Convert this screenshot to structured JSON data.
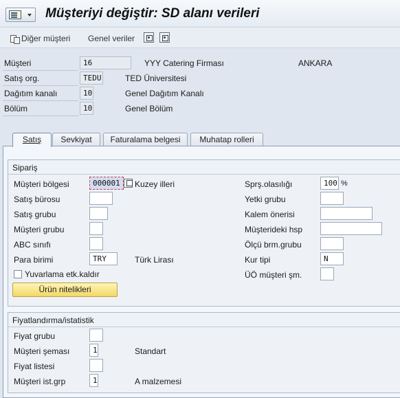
{
  "window": {
    "title": "Müşteriyi değiştir: SD alanı verileri"
  },
  "toolbar": {
    "other_customer": "Diğer müşteri",
    "general_data": "Genel veriler"
  },
  "header": {
    "customer_label": "Müşteri",
    "customer_value": "16",
    "customer_name": "YYY Catering Firması",
    "customer_city": "ANKARA",
    "sales_org_label": "Satış org.",
    "sales_org_value": "TEDU",
    "sales_org_name": "TED Üniversitesi",
    "dist_channel_label": "Dağıtım kanalı",
    "dist_channel_value": "10",
    "dist_channel_name": "Genel Dağıtım Kanalı",
    "division_label": "Bölüm",
    "division_value": "10",
    "division_name": "Genel Bölüm"
  },
  "tabs": [
    {
      "label": "Satış",
      "active": true
    },
    {
      "label": "Sevkiyat",
      "active": false
    },
    {
      "label": "Faturalama belgesi",
      "active": false
    },
    {
      "label": "Muhatap rolleri",
      "active": false
    }
  ],
  "order_group": {
    "title": "Sipariş",
    "sales_district_label": "Müşteri bölgesi",
    "sales_district_value": "000001",
    "sales_district_text": "Kuzey illeri",
    "sales_office_label": "Satış bürosu",
    "sales_office_value": "",
    "sales_group_label": "Satış grubu",
    "sales_group_value": "",
    "customer_group_label": "Müşteri grubu",
    "customer_group_value": "",
    "abc_class_label": "ABC sınıfı",
    "abc_class_value": "",
    "currency_label": "Para birimi",
    "currency_value": "TRY",
    "currency_text": "Türk Lirası",
    "rounding_label": "Yuvarlama etk.kaldır",
    "product_attr_button": "Ürün nitelikleri",
    "order_prob_label": "Sprş.olasılığı",
    "order_prob_value": "100",
    "order_prob_unit": "%",
    "auth_group_label": "Yetki grubu",
    "auth_group_value": "",
    "item_proposal_label": "Kalem önerisi",
    "item_proposal_value": "",
    "account_at_cust_label": "Müşterideki hsp",
    "account_at_cust_value": "",
    "uom_group_label": "Ölçü brm.grubu",
    "uom_group_value": "",
    "exch_rate_label": "Kur tipi",
    "exch_rate_value": "N",
    "pp_cust_proc_label": "ÜÖ müşteri şm.",
    "pp_cust_proc_value": ""
  },
  "pricing_group": {
    "title": "Fiyatlandırma/istatistik",
    "price_group_label": "Fiyat grubu",
    "price_group_value": "",
    "cust_pric_proc_label": "Müşteri şeması",
    "cust_pric_proc_value": "1",
    "cust_pric_proc_text": "Standart",
    "price_list_label": "Fiyat listesi",
    "price_list_value": "",
    "cust_stats_grp_label": "Müşteri ist.grp",
    "cust_stats_grp_value": "1",
    "cust_stats_grp_text": "A malzemesi"
  }
}
